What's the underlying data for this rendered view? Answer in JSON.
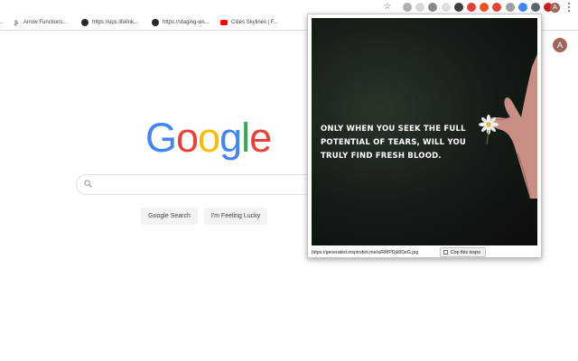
{
  "toolbar": {
    "star_icon": "star-icon",
    "extensions": [
      {
        "name": "extension-gray-icon",
        "color": "#b0b0b0"
      },
      {
        "name": "extension-square-icon",
        "color": "#d8d8d8"
      },
      {
        "name": "extension-gear-icon",
        "color": "#8a8a8a"
      },
      {
        "name": "extension-page-icon",
        "color": "#e0e0e0"
      },
      {
        "name": "extension-info-icon",
        "color": "#3c4043"
      },
      {
        "name": "extension-red-icon",
        "color": "#e94235"
      },
      {
        "name": "extension-orange-icon",
        "color": "#f4511e"
      },
      {
        "name": "extension-gmail-icon",
        "color": "#ea4335"
      },
      {
        "name": "extension-gray2-icon",
        "color": "#9aa0a6"
      },
      {
        "name": "extension-globe-icon",
        "color": "#4285f4"
      },
      {
        "name": "extension-dark-icon",
        "color": "#5f6368"
      },
      {
        "name": "extension-red2-icon",
        "color": "#c5221f"
      }
    ],
    "avatar_letter": "A"
  },
  "bookmarks": [
    {
      "label": "...",
      "icon": "arrow"
    },
    {
      "label": "Arrow Functions...",
      "icon": "arrow"
    },
    {
      "label": "https://ops.lifelink...",
      "icon": "github"
    },
    {
      "label": "https://staging-ws...",
      "icon": "github"
    },
    {
      "label": "Cities Skylines | F...",
      "icon": "youtube"
    }
  ],
  "google": {
    "logo_letters": [
      {
        "ch": "G",
        "color": "#4285f4"
      },
      {
        "ch": "o",
        "color": "#ea4335"
      },
      {
        "ch": "o",
        "color": "#fbbc05"
      },
      {
        "ch": "g",
        "color": "#4285f4"
      },
      {
        "ch": "l",
        "color": "#34a853"
      },
      {
        "ch": "e",
        "color": "#ea4335"
      }
    ],
    "search_value": "",
    "search_button": "Google Search",
    "lucky_button": "I'm Feeling Lucky",
    "avatar_letter": "A"
  },
  "popup": {
    "quote": "ONLY WHEN YOU SEEK THE FULL POTENTIAL OF TEARS, WILL YOU TRULY FIND FRESH BLOOD.",
    "url": "https://generated.inspirobot.me/a/RMPDjk8DeG.jpg",
    "copy_button": "Cop this inspo"
  }
}
